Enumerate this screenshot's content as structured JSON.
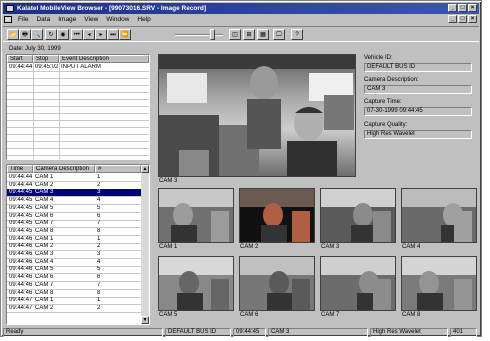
{
  "window": {
    "title": "Kalatel MobileView Browser - [99073016.SRV - Image Record]",
    "controls": [
      "_",
      "□",
      "×"
    ],
    "mdi_controls": [
      "_",
      "□",
      "×"
    ]
  },
  "menu": [
    "File",
    "Data",
    "Image",
    "View",
    "Window",
    "Help"
  ],
  "toolbar": {
    "buttons": [
      {
        "icon": "open-icon",
        "glyph": "📂"
      },
      {
        "icon": "print-icon",
        "glyph": "🖶"
      },
      {
        "icon": "preview-icon",
        "glyph": "🔍"
      },
      {
        "icon": "refresh-icon",
        "glyph": "↻"
      },
      {
        "icon": "record-icon",
        "glyph": "◉"
      },
      {
        "icon": "first-frame-icon",
        "glyph": "⏮"
      },
      {
        "icon": "prev-frame-icon",
        "glyph": "◂"
      },
      {
        "icon": "next-frame-icon",
        "glyph": "▸"
      },
      {
        "icon": "last-frame-icon",
        "glyph": "⏭"
      },
      {
        "icon": "fast-forward-icon",
        "glyph": "⏩"
      },
      {
        "icon": "single-view-icon",
        "glyph": "◫"
      },
      {
        "icon": "quad-view-icon",
        "glyph": "⊞"
      },
      {
        "icon": "multi-view-icon",
        "glyph": "▦"
      },
      {
        "icon": "export-icon",
        "glyph": "🖵"
      },
      {
        "icon": "help-icon",
        "glyph": "?"
      }
    ]
  },
  "date_label": "Date: July 30, 1999",
  "events": {
    "headers": [
      "Start",
      "Stop",
      "Event Description"
    ],
    "rows": [
      [
        "09:44:44",
        "09:45:02",
        "INPUT ALARM"
      ]
    ]
  },
  "cameras": {
    "headers": [
      "Time",
      "Camera Description",
      "#"
    ],
    "rows": [
      [
        "09:44:44",
        "CAM 1",
        "1"
      ],
      [
        "09:44:44",
        "CAM 2",
        "2"
      ],
      [
        "09:44:45",
        "CAM 3",
        "3"
      ],
      [
        "09:44:45",
        "CAM 4",
        "4"
      ],
      [
        "09:44:45",
        "CAM 5",
        "5"
      ],
      [
        "09:44:45",
        "CAM 6",
        "6"
      ],
      [
        "09:44:45",
        "CAM 7",
        "7"
      ],
      [
        "09:44:45",
        "CAM 8",
        "8"
      ],
      [
        "09:44:46",
        "CAM 1",
        "1"
      ],
      [
        "09:44:46",
        "CAM 2",
        "2"
      ],
      [
        "09:44:46",
        "CAM 3",
        "3"
      ],
      [
        "09:44:46",
        "CAM 4",
        "4"
      ],
      [
        "09:44:46",
        "CAM 5",
        "5"
      ],
      [
        "09:44:46",
        "CAM 6",
        "6"
      ],
      [
        "09:44:46",
        "CAM 7",
        "7"
      ],
      [
        "09:44:46",
        "CAM 8",
        "8"
      ],
      [
        "09:44:47",
        "CAM 1",
        "1"
      ],
      [
        "09:44:47",
        "CAM 2",
        "2"
      ]
    ],
    "selected_index": 2
  },
  "main_view": {
    "caption": "CAM 3"
  },
  "info": {
    "vehicle_label": "Vehicle ID:",
    "vehicle_value": "DEFAULT BUS ID",
    "camera_label": "Camera Description:",
    "camera_value": "CAM 3",
    "capture_time_label": "Capture Time:",
    "capture_time_value": "07-30-1999 09:44:45",
    "quality_label": "Capture Quality:",
    "quality_value": "High Res Wavelet"
  },
  "thumbnails": [
    "CAM 1",
    "CAM 2",
    "CAM 3",
    "CAM 4",
    "CAM 5",
    "CAM 6",
    "CAM 7",
    "CAM 8"
  ],
  "status": {
    "ready": "Ready",
    "bus": "DEFAULT BUS ID",
    "time": "09:44:45",
    "cam": "CAM 3",
    "quality": "High Res Wavelet",
    "count": "401"
  },
  "colors": {
    "title_bar": "#1d2f86",
    "selection": "#000080",
    "window_bg": "#c0c0c0"
  }
}
